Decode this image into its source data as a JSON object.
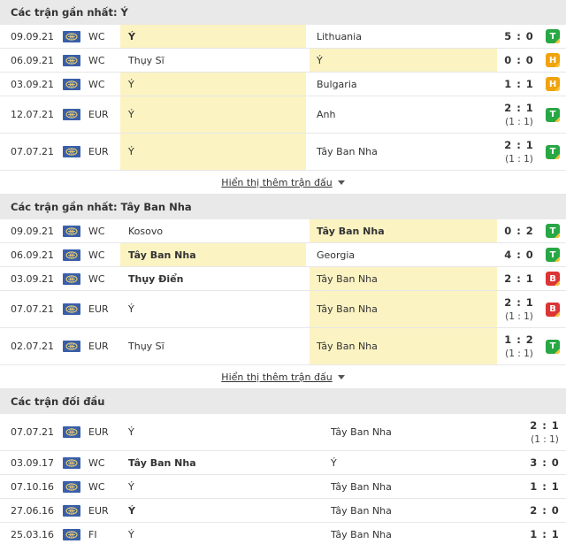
{
  "sections": {
    "italy": {
      "title": "Các trận gần nhất: Ý",
      "more": "Hiển thị thêm trận đấu",
      "rows": [
        {
          "date": "09.09.21",
          "comp": "WC",
          "home": "Ý",
          "away": "Lithuania",
          "score": "5 : 0",
          "sub": "",
          "res": "T",
          "home_hl": true,
          "away_hl": false,
          "home_bold": true,
          "away_bold": false,
          "tall": false
        },
        {
          "date": "06.09.21",
          "comp": "WC",
          "home": "Thụy Sĩ",
          "away": "Ý",
          "score": "0 : 0",
          "sub": "",
          "res": "H",
          "home_hl": false,
          "away_hl": true,
          "home_bold": false,
          "away_bold": false,
          "tall": false
        },
        {
          "date": "03.09.21",
          "comp": "WC",
          "home": "Ý",
          "away": "Bulgaria",
          "score": "1 : 1",
          "sub": "",
          "res": "H",
          "home_hl": true,
          "away_hl": false,
          "home_bold": false,
          "away_bold": false,
          "tall": false
        },
        {
          "date": "12.07.21",
          "comp": "EUR",
          "home": "Ý",
          "away": "Anh",
          "score": "2 : 1",
          "sub": "(1 : 1)",
          "res": "T",
          "home_hl": true,
          "away_hl": false,
          "home_bold": false,
          "away_bold": false,
          "tall": true
        },
        {
          "date": "07.07.21",
          "comp": "EUR",
          "home": "Ý",
          "away": "Tây Ban Nha",
          "score": "2 : 1",
          "sub": "(1 : 1)",
          "res": "T",
          "home_hl": true,
          "away_hl": false,
          "home_bold": false,
          "away_bold": false,
          "tall": true
        }
      ]
    },
    "spain": {
      "title": "Các trận gần nhất: Tây Ban Nha",
      "more": "Hiển thị thêm trận đấu",
      "rows": [
        {
          "date": "09.09.21",
          "comp": "WC",
          "home": "Kosovo",
          "away": "Tây Ban Nha",
          "score": "0 : 2",
          "sub": "",
          "res": "T",
          "home_hl": false,
          "away_hl": true,
          "home_bold": false,
          "away_bold": true,
          "tall": false
        },
        {
          "date": "06.09.21",
          "comp": "WC",
          "home": "Tây Ban Nha",
          "away": "Georgia",
          "score": "4 : 0",
          "sub": "",
          "res": "T",
          "home_hl": true,
          "away_hl": false,
          "home_bold": true,
          "away_bold": false,
          "tall": false
        },
        {
          "date": "03.09.21",
          "comp": "WC",
          "home": "Thụy Điển",
          "away": "Tây Ban Nha",
          "score": "2 : 1",
          "sub": "",
          "res": "B",
          "home_hl": false,
          "away_hl": true,
          "home_bold": true,
          "away_bold": false,
          "tall": false
        },
        {
          "date": "07.07.21",
          "comp": "EUR",
          "home": "Ý",
          "away": "Tây Ban Nha",
          "score": "2 : 1",
          "sub": "(1 : 1)",
          "res": "B",
          "home_hl": false,
          "away_hl": true,
          "home_bold": false,
          "away_bold": false,
          "tall": true
        },
        {
          "date": "02.07.21",
          "comp": "EUR",
          "home": "Thụy Sĩ",
          "away": "Tây Ban Nha",
          "score": "1 : 2",
          "sub": "(1 : 1)",
          "res": "T",
          "home_hl": false,
          "away_hl": true,
          "home_bold": false,
          "away_bold": false,
          "tall": true
        }
      ]
    },
    "h2h": {
      "title": "Các trận đối đầu",
      "rows": [
        {
          "date": "07.07.21",
          "comp": "EUR",
          "home": "Ý",
          "away": "Tây Ban Nha",
          "score": "2 : 1",
          "sub": "(1 : 1)",
          "home_bold": false,
          "away_bold": false,
          "tall": true
        },
        {
          "date": "03.09.17",
          "comp": "WC",
          "home": "Tây Ban Nha",
          "away": "Ý",
          "score": "3 : 0",
          "sub": "",
          "home_bold": true,
          "away_bold": false,
          "tall": false
        },
        {
          "date": "07.10.16",
          "comp": "WC",
          "home": "Ý",
          "away": "Tây Ban Nha",
          "score": "1 : 1",
          "sub": "",
          "home_bold": false,
          "away_bold": false,
          "tall": false
        },
        {
          "date": "27.06.16",
          "comp": "EUR",
          "home": "Ý",
          "away": "Tây Ban Nha",
          "score": "2 : 0",
          "sub": "",
          "home_bold": true,
          "away_bold": false,
          "tall": false
        },
        {
          "date": "25.03.16",
          "comp": "FI",
          "home": "Ý",
          "away": "Tây Ban Nha",
          "score": "1 : 1",
          "sub": "",
          "home_bold": false,
          "away_bold": false,
          "tall": false
        }
      ]
    }
  },
  "colors": {
    "win": "#28a745",
    "draw": "#f0a30a",
    "loss": "#dc3535",
    "highlight": "#fbf3c2"
  },
  "icons": {
    "competition_flag": "world-flag-icon",
    "result_badge": "result-badge-icon",
    "expand": "caret-down-icon"
  }
}
